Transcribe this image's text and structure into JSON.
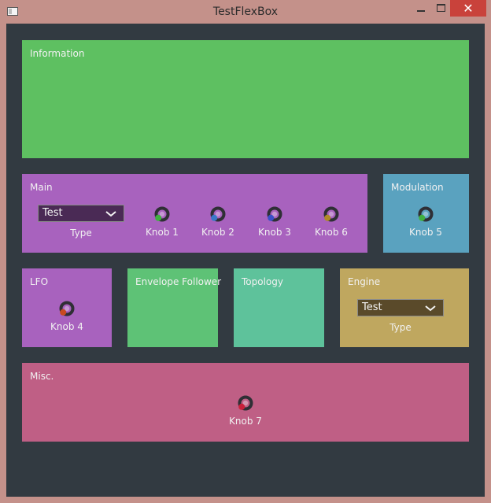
{
  "window": {
    "title": "TestFlexBox",
    "close_glyph": "✕"
  },
  "colors": {
    "window_border": "#c4918a",
    "content_bg": "#323a41",
    "information": "#5ec061",
    "main": "#a862be",
    "modulation": "#5aa2bf",
    "lfo": "#a862be",
    "envelope": "#5ec276",
    "topology": "#5ec29b",
    "engine": "#bfa75f",
    "misc": "#bf5f85"
  },
  "panels": {
    "information": {
      "title": "Information"
    },
    "main": {
      "title": "Main",
      "combo": {
        "value": "Test",
        "label": "Type"
      },
      "knobs": [
        {
          "label": "Knob 1",
          "color": "#3fb040"
        },
        {
          "label": "Knob 2",
          "color": "#3a78c8"
        },
        {
          "label": "Knob 3",
          "color": "#3a4fc8"
        },
        {
          "label": "Knob 6",
          "color": "#b08a28"
        }
      ]
    },
    "modulation": {
      "title": "Modulation",
      "knob": {
        "label": "Knob 5",
        "color": "#3fb040"
      }
    },
    "lfo": {
      "title": "LFO",
      "knob": {
        "label": "Knob 4",
        "color": "#c84a20"
      }
    },
    "envelope": {
      "title": "Envelope Follower"
    },
    "topology": {
      "title": "Topology"
    },
    "engine": {
      "title": "Engine",
      "combo": {
        "value": "Test",
        "label": "Type"
      }
    },
    "misc": {
      "title": "Misc.",
      "knob": {
        "label": "Knob 7",
        "color": "#c8203a"
      }
    }
  }
}
